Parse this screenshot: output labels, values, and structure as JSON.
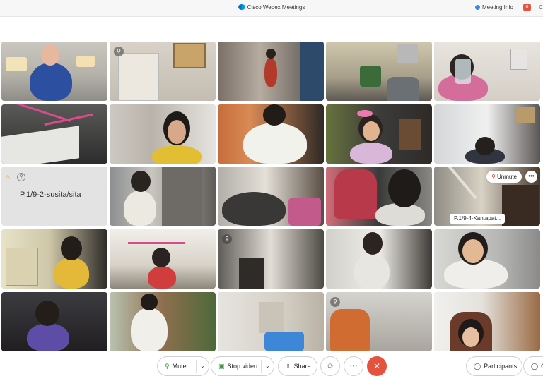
{
  "window": {
    "title": "Cisco Webex Meetings",
    "meeting_info": "Meeting Info",
    "notification_count": "0",
    "topright_label": "C"
  },
  "tiles": {
    "name_tile_label": "P.1/9-2-susita/sita",
    "pinned_label": "P.1/9-4-Kantapat...",
    "unmute_label": "Unmute",
    "more_label": "•••"
  },
  "controls": {
    "mute": "Mute",
    "stop_video": "Stop video",
    "share": "Share",
    "participants": "Participants",
    "chat": "Ch"
  },
  "colors": {
    "accent_green": "#3d9a45",
    "leave_red": "#e5533e",
    "webex_blue": "#1170cf"
  }
}
